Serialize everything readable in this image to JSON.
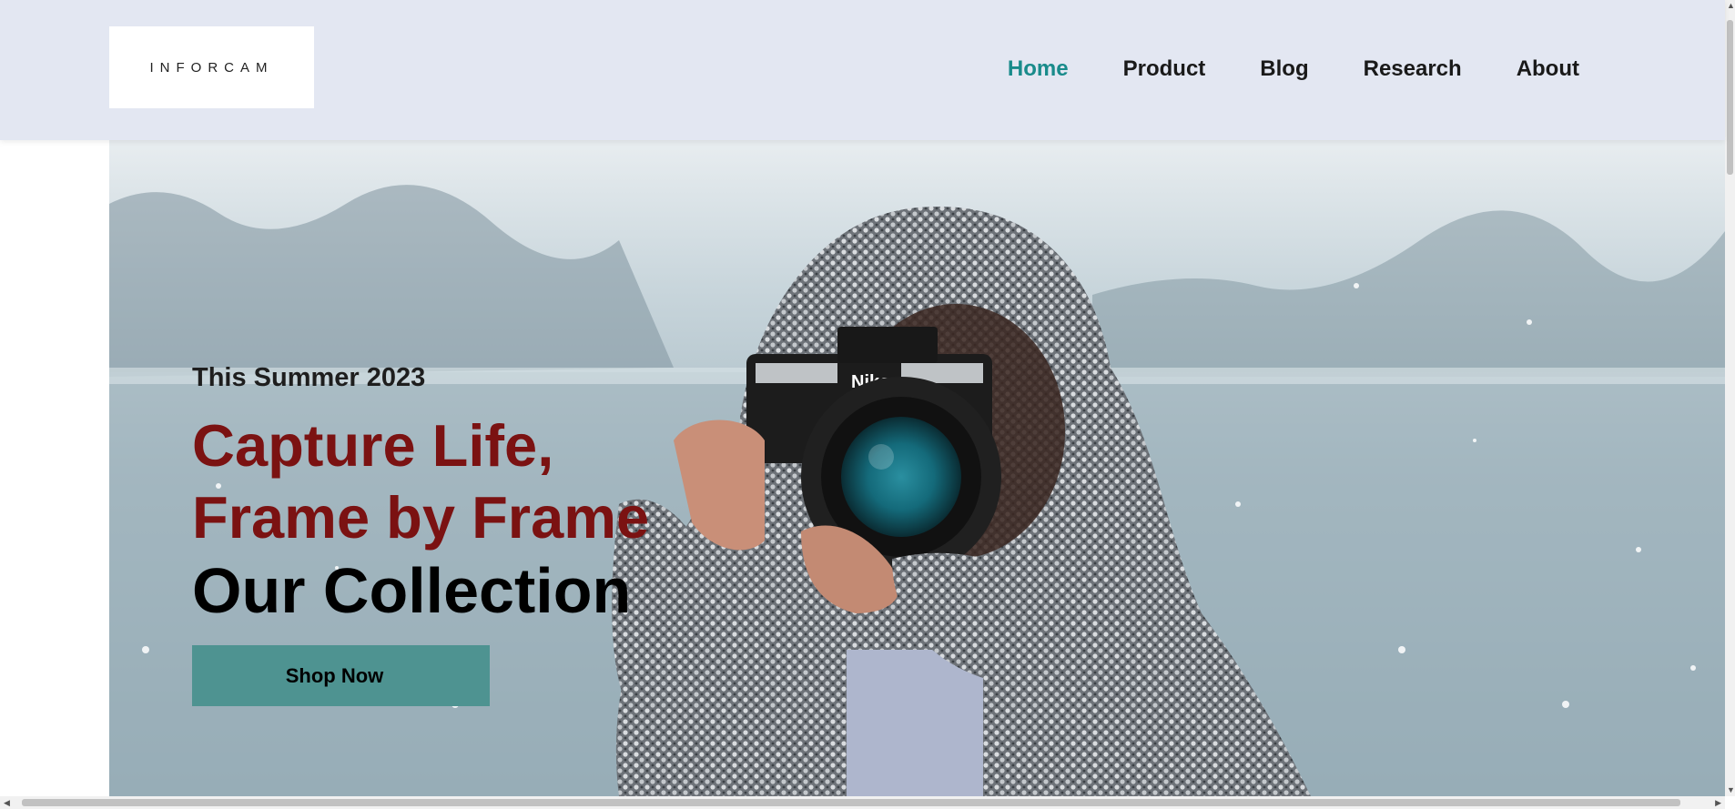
{
  "header": {
    "logo_text": "INFORCAM",
    "nav": [
      {
        "label": "Home",
        "active": true
      },
      {
        "label": "Product",
        "active": false
      },
      {
        "label": "Blog",
        "active": false
      },
      {
        "label": "Research",
        "active": false
      },
      {
        "label": "About",
        "active": false
      }
    ]
  },
  "hero": {
    "subtitle": "This Summer 2023",
    "headline_line1": "Capture Life,",
    "headline_line2": "Frame by Frame",
    "collection": "Our Collection",
    "cta_label": "Shop Now",
    "camera_brand": "Nikon"
  },
  "colors": {
    "header_bg": "#e3e7f2",
    "nav_active": "#198b8b",
    "headline": "#7b1212",
    "cta_bg": "#4e9391"
  }
}
